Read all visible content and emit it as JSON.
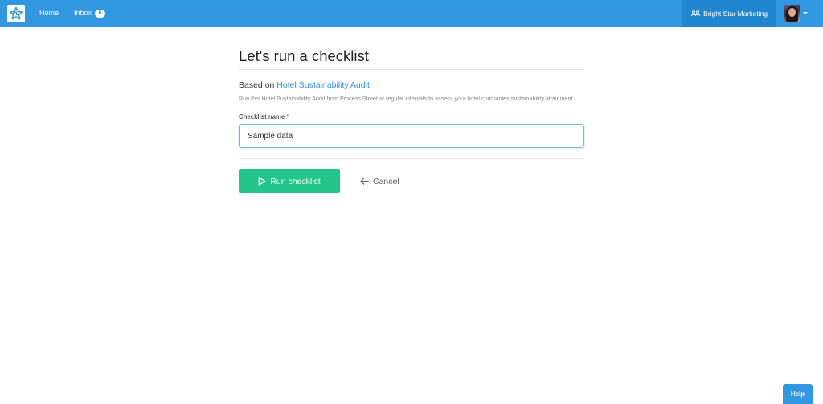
{
  "nav": {
    "home_label": "Home",
    "inbox_label": "Inbox",
    "inbox_count": "6",
    "org_name": "Bright Star Marketing"
  },
  "page": {
    "title": "Let's run a checklist",
    "based_on_prefix": "Based on",
    "template_name": "Hotel Sustainability Audit",
    "description": "Run this Hotel Sustainability Audit from Process Street at regular intervals to assess your hotel companies sustainability attainment."
  },
  "form": {
    "name_label": "Checklist name",
    "required_mark": "*",
    "name_value": "Sample data"
  },
  "actions": {
    "run_label": "Run checklist",
    "cancel_label": "Cancel"
  },
  "help_label": "Help",
  "colors": {
    "topbar": "#3197e0",
    "org_active": "#1f86cf",
    "run_button": "#23c58d",
    "link": "#3197e0"
  },
  "icons": {
    "logo": "star-logo-icon",
    "org": "users-icon",
    "run": "play-icon",
    "cancel": "arrow-left-icon"
  }
}
